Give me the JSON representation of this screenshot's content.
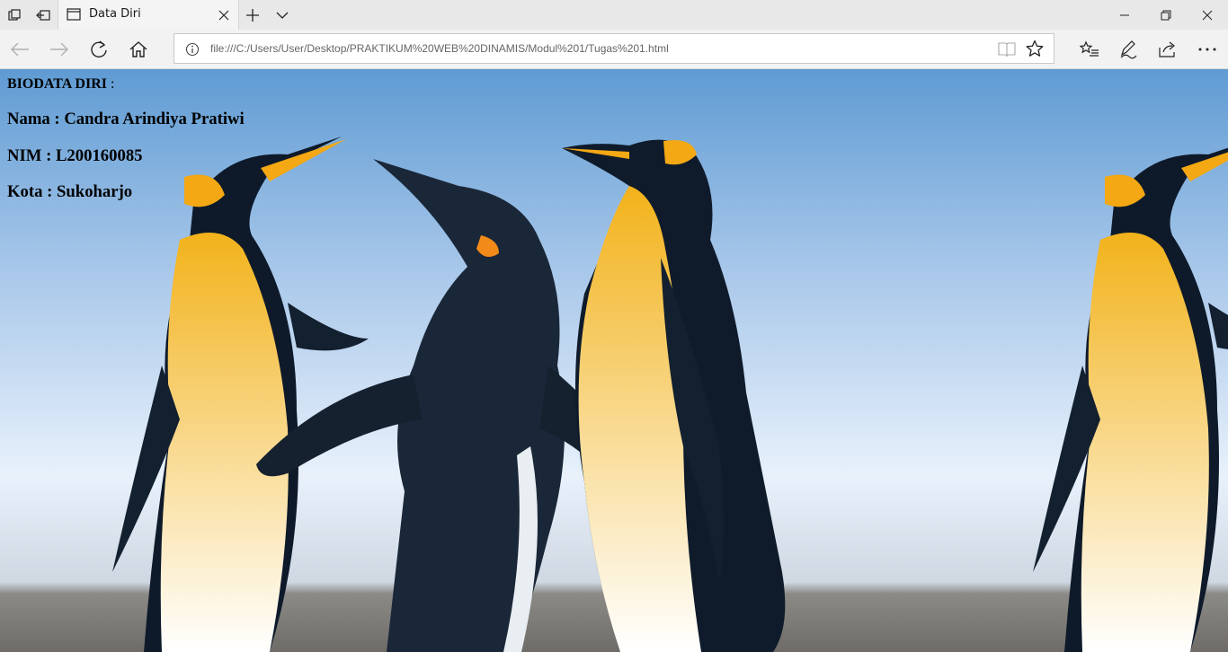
{
  "browser": {
    "tab_title": "Data Diri",
    "url": "file:///C:/Users/User/Desktop/PRAKTIKUM%20WEB%20DINAMIS/Modul%201/Tugas%201.html"
  },
  "page": {
    "heading": "BIODATA DIRI",
    "heading_suffix": " :",
    "name_line": "Nama : Candra Arindiya Pratiwi",
    "nim_line": "NIM : L200160085",
    "city_line": "Kota : Sukoharjo"
  },
  "icons": {
    "tab_manager": "tab-manager-icon",
    "tab_aside": "set-tabs-aside-icon",
    "tab_page": "page-icon",
    "close": "close-icon",
    "new_tab": "plus-icon",
    "tab_preview": "chevron-down-icon",
    "back": "back-arrow-icon",
    "forward": "forward-arrow-icon",
    "refresh": "refresh-icon",
    "home": "home-icon",
    "info": "info-icon",
    "reading_view": "reading-view-icon",
    "favorite": "star-icon",
    "favorites_hub": "favorites-hub-icon",
    "web_notes": "pen-icon",
    "share": "share-icon",
    "more": "more-icon"
  },
  "colors": {
    "tabbar_bg": "#e8e8e8",
    "navbar_bg": "#f2f2f2",
    "sky": "#7aa8d8"
  }
}
